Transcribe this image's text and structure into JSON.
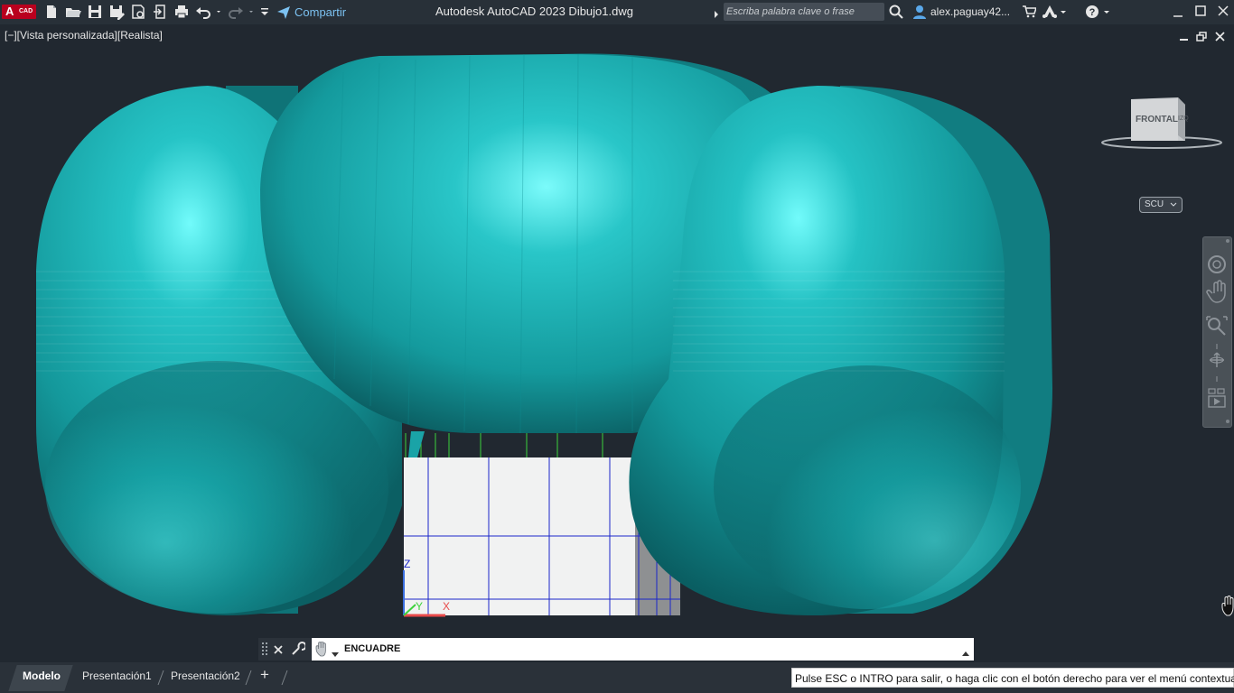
{
  "app": {
    "badge_letter": "A",
    "badge_sub": "CAD",
    "title": "Autodesk AutoCAD 2023   Dibujo1.dwg",
    "share_label": "Compartir"
  },
  "search": {
    "placeholder": "Escriba palabra clave o frase"
  },
  "user": {
    "name": "alex.paguay42..."
  },
  "viewport": {
    "label": "[−][Vista personalizada][Realista]",
    "viewcube_face": "FRONTAL",
    "viewcube_side": "IZQ",
    "ucs_label": "SCU",
    "axis_z": "Z",
    "axis_y": "Y",
    "axis_x": "X",
    "object_color": "#17a3a8",
    "background": "#212830"
  },
  "command": {
    "current": "ENCUADRE"
  },
  "layout_tabs": [
    {
      "label": "Modelo",
      "active": true
    },
    {
      "label": "Presentación1",
      "active": false
    },
    {
      "label": "Presentación2",
      "active": false
    }
  ],
  "add_tab_label": "+",
  "status": {
    "message": "Pulse ESC o INTRO para salir, o haga clic con el botón derecho para ver el menú contextual."
  },
  "icons": {
    "quick_access": [
      "new-icon",
      "open-icon",
      "save-icon",
      "save-as-icon",
      "plot-preview-icon",
      "import-icon",
      "print-icon",
      "undo-icon",
      "redo-icon",
      "customize-icon"
    ],
    "share": "send-icon",
    "search": "search-icon",
    "user": "user-icon",
    "cart": "cart-icon",
    "autodesk": "autodesk-icon",
    "help": "help-icon"
  }
}
